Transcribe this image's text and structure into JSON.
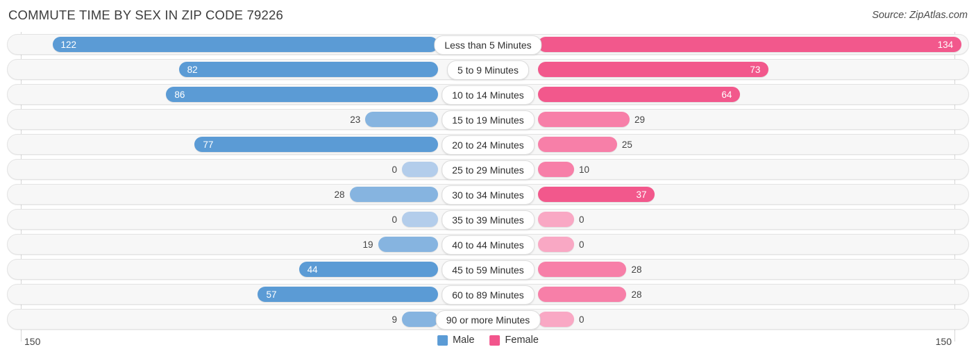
{
  "header": {
    "title": "COMMUTE TIME BY SEX IN ZIP CODE 79226",
    "source": "Source: ZipAtlas.com"
  },
  "axis": {
    "left_max": "150",
    "right_max": "150"
  },
  "legend": {
    "items": [
      {
        "label": "Male",
        "color": "#5b9bd5"
      },
      {
        "label": "Female",
        "color": "#f2558c"
      }
    ]
  },
  "colors": {
    "male_strong": "#5b9bd5",
    "male_mid": "#86b4e0",
    "male_light": "#b3cdeb",
    "female_strong": "#f2588c",
    "female_mid": "#f77fa8",
    "female_light": "#f9a8c4",
    "track": "#f7f7f7",
    "track_border": "#e3e3e3"
  },
  "chart_data": {
    "type": "bar",
    "title": "COMMUTE TIME BY SEX IN ZIP CODE 79226",
    "subtitle": "Source: ZipAtlas.com",
    "orientation": "horizontal-diverging",
    "xlabel": "",
    "ylabel": "",
    "xlim": [
      150,
      150
    ],
    "grid": true,
    "legend_position": "bottom-center",
    "categories": [
      "Less than 5 Minutes",
      "5 to 9 Minutes",
      "10 to 14 Minutes",
      "15 to 19 Minutes",
      "20 to 24 Minutes",
      "25 to 29 Minutes",
      "30 to 34 Minutes",
      "35 to 39 Minutes",
      "40 to 44 Minutes",
      "45 to 59 Minutes",
      "60 to 89 Minutes",
      "90 or more Minutes"
    ],
    "series": [
      {
        "name": "Male",
        "values": [
          122,
          82,
          86,
          23,
          77,
          0,
          28,
          0,
          19,
          44,
          57,
          9
        ]
      },
      {
        "name": "Female",
        "values": [
          134,
          73,
          64,
          29,
          25,
          10,
          37,
          0,
          0,
          28,
          28,
          0
        ]
      }
    ]
  },
  "rows": [
    {
      "label": "Less than 5 Minutes",
      "male": "122",
      "female": "134"
    },
    {
      "label": "5 to 9 Minutes",
      "male": "82",
      "female": "73"
    },
    {
      "label": "10 to 14 Minutes",
      "male": "86",
      "female": "64"
    },
    {
      "label": "15 to 19 Minutes",
      "male": "23",
      "female": "29"
    },
    {
      "label": "20 to 24 Minutes",
      "male": "77",
      "female": "25"
    },
    {
      "label": "25 to 29 Minutes",
      "male": "0",
      "female": "10"
    },
    {
      "label": "30 to 34 Minutes",
      "male": "28",
      "female": "37"
    },
    {
      "label": "35 to 39 Minutes",
      "male": "0",
      "female": "0"
    },
    {
      "label": "40 to 44 Minutes",
      "male": "19",
      "female": "0"
    },
    {
      "label": "45 to 59 Minutes",
      "male": "44",
      "female": "28"
    },
    {
      "label": "60 to 89 Minutes",
      "male": "57",
      "female": "28"
    },
    {
      "label": "90 or more Minutes",
      "male": "9",
      "female": "0"
    }
  ]
}
